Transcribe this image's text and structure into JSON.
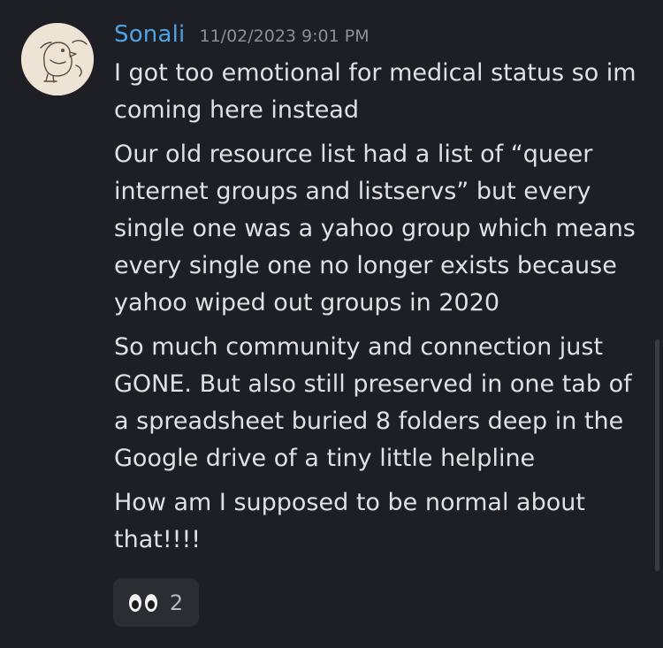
{
  "message": {
    "author": "Sonali",
    "timestamp": "11/02/2023 9:01 PM",
    "paragraphs": [
      {
        "lines": [
          "I got too emotional for medical status so im",
          "coming here instead"
        ]
      },
      {
        "lines": [
          "Our old resource list had a list of “queer",
          "internet groups and listservs” but every",
          "single one was a yahoo group which means",
          "every single one no longer exists because",
          "yahoo wiped out groups in 2020"
        ]
      },
      {
        "lines": [
          "So much community and connection just",
          "GONE. But also still preserved in one tab of",
          "a spreadsheet buried 8 folders deep in the",
          "Google drive of a tiny little helpline"
        ]
      },
      {
        "lines": [
          "How am I supposed to be normal about",
          "that!!!!"
        ]
      }
    ],
    "reaction": {
      "emoji": "eyes-icon",
      "count": "2"
    }
  },
  "colors": {
    "background": "#1e1f24",
    "username": "#4ea3e8",
    "timestamp": "#8e9096",
    "text": "#dfe0e3",
    "reaction_bg": "#2c2d33"
  }
}
